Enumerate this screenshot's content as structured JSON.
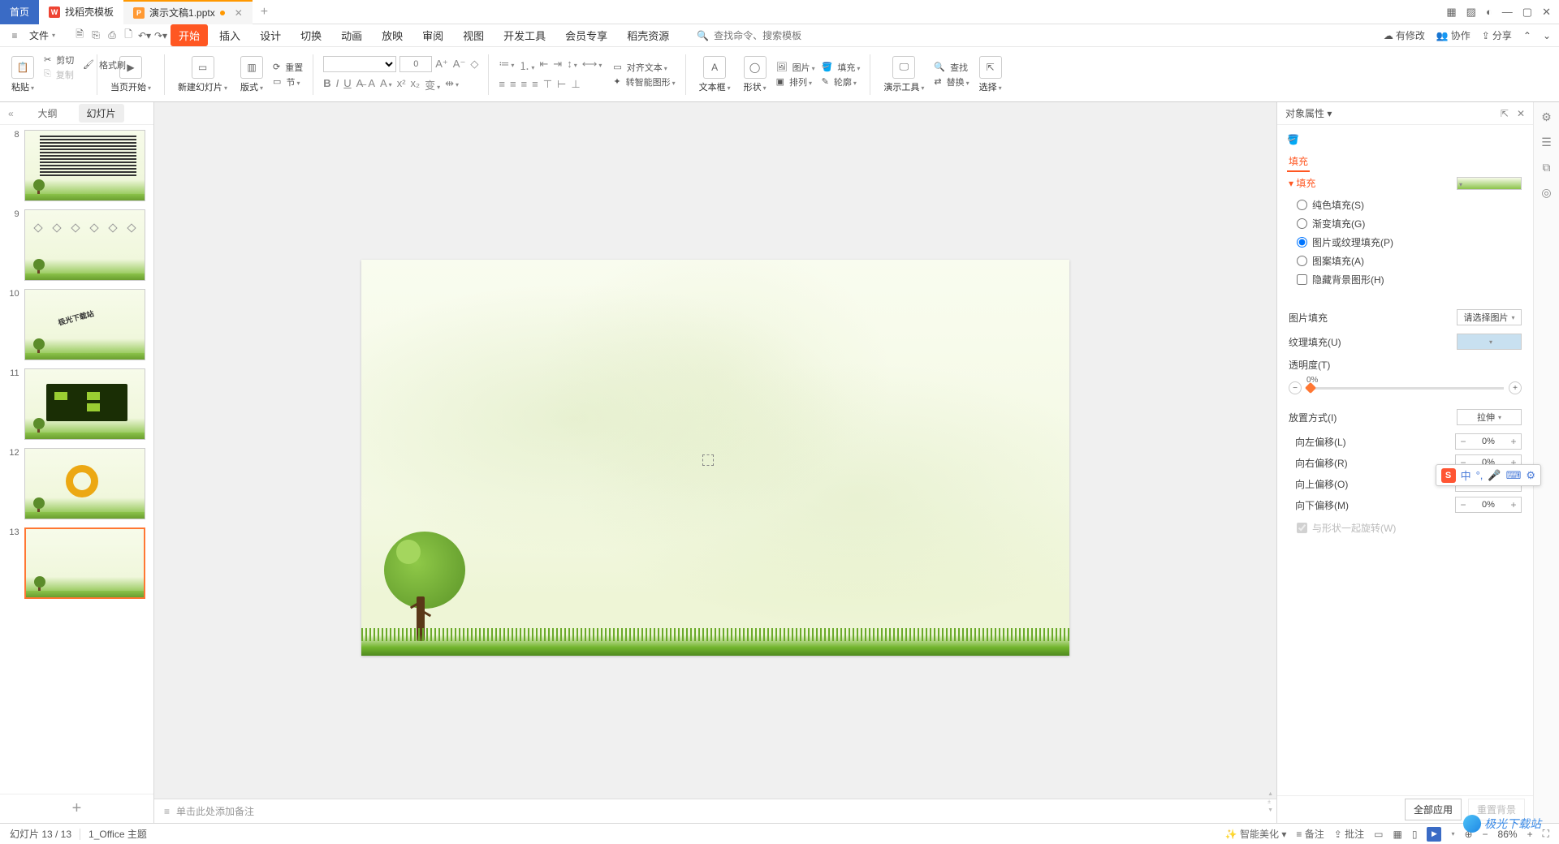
{
  "tabs": {
    "home": "首页",
    "t1": "找稻壳模板",
    "t2": "演示文稿1.pptx"
  },
  "win_ctrl": {
    "grid1": "▦",
    "grid2": "▨",
    "user": "◐",
    "min": "—",
    "max": "▢",
    "close": "✕"
  },
  "menu": {
    "file": "文件",
    "items": [
      "开始",
      "插入",
      "设计",
      "切换",
      "动画",
      "放映",
      "审阅",
      "视图",
      "开发工具",
      "会员专享",
      "稻壳资源"
    ],
    "search_ph": "查找命令、搜索模板",
    "right": {
      "mod": "有修改",
      "coop": "协作",
      "share": "分享"
    }
  },
  "toolbar": {
    "paste": "粘贴",
    "cut": "剪切",
    "copy": "复制",
    "format": "格式刷",
    "startpage": "当页开始",
    "newslide": "新建幻灯片",
    "layout": "版式",
    "section": "节",
    "reset": "重置",
    "fontsize_ph": "0",
    "aligntext": "对齐文本",
    "smartart": "转智能图形",
    "textbox": "文本框",
    "shape": "形状",
    "image": "图片",
    "fill": "填充",
    "arrange": "排列",
    "outline": "轮廓",
    "find": "查找",
    "tools": "演示工具",
    "replace": "替换",
    "select": "选择"
  },
  "slide_tabs": {
    "outline": "大纲",
    "slides": "幻灯片"
  },
  "thumbs": [
    {
      "n": "8"
    },
    {
      "n": "9"
    },
    {
      "n": "10",
      "txt": "极光下载站"
    },
    {
      "n": "11"
    },
    {
      "n": "12"
    },
    {
      "n": "13"
    }
  ],
  "notes": {
    "ph": "单击此处添加备注"
  },
  "prop": {
    "title": "对象属性",
    "tab_fill": "填充",
    "sect": "填充",
    "r_solid": "纯色填充(S)",
    "r_grad": "渐变填充(G)",
    "r_pic": "图片或纹理填充(P)",
    "r_pat": "图案填充(A)",
    "c_hide": "隐藏背景图形(H)",
    "pic_fill": "图片填充",
    "pic_fill_v": "请选择图片",
    "tex_fill": "纹理填充(U)",
    "opacity": "透明度(T)",
    "opacity_v": "0%",
    "placement": "放置方式(I)",
    "placement_v": "拉伸",
    "off_l": "向左偏移(L)",
    "off_r": "向右偏移(R)",
    "off_t": "向上偏移(O)",
    "off_b": "向下偏移(M)",
    "off_val": "0%",
    "rotate": "与形状一起旋转(W)",
    "apply_all": "全部应用",
    "reset_bg": "重置背景"
  },
  "status": {
    "slide": "幻灯片 13 / 13",
    "theme": "1_Office 主题",
    "beauty": "智能美化",
    "notes": "备注",
    "comment": "批注",
    "zoom": "86%"
  },
  "ime": {
    "lang": "中"
  },
  "watermark": "极光下载站"
}
